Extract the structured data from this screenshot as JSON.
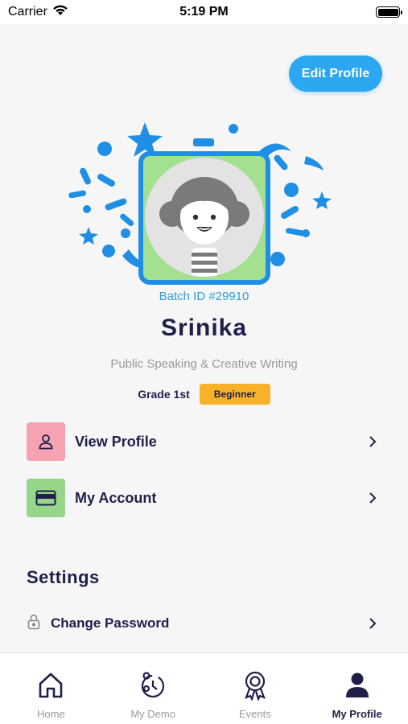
{
  "status_bar": {
    "carrier": "Carrier",
    "time": "5:19 PM"
  },
  "header": {
    "edit_profile_label": "Edit Profile"
  },
  "profile": {
    "batch_id": "Batch ID #29910",
    "name": "Srinika",
    "subtitle": "Public Speaking & Creative Writing",
    "grade": "Grade 1st",
    "level": "Beginner"
  },
  "menu": {
    "items": [
      {
        "label": "View Profile",
        "icon": "user-icon",
        "color": "#f5a3b3"
      },
      {
        "label": "My Account",
        "icon": "card-icon",
        "color": "#95d68a"
      }
    ]
  },
  "settings": {
    "title": "Settings",
    "items": [
      {
        "label": "Change Password",
        "icon": "lock-icon"
      }
    ]
  },
  "tabbar": {
    "items": [
      {
        "label": "Home",
        "icon": "home-icon",
        "active": false
      },
      {
        "label": "My Demo",
        "icon": "demo-clock-icon",
        "active": false
      },
      {
        "label": "Events",
        "icon": "award-icon",
        "active": false
      },
      {
        "label": "My Profile",
        "icon": "profile-icon",
        "active": true
      }
    ]
  },
  "colors": {
    "accent": "#2aa7f0",
    "dark_text": "#1f1f4a",
    "badge": "#f7b228",
    "avatar_bg": "#a3e08f",
    "frame": "#1f8fe6"
  }
}
